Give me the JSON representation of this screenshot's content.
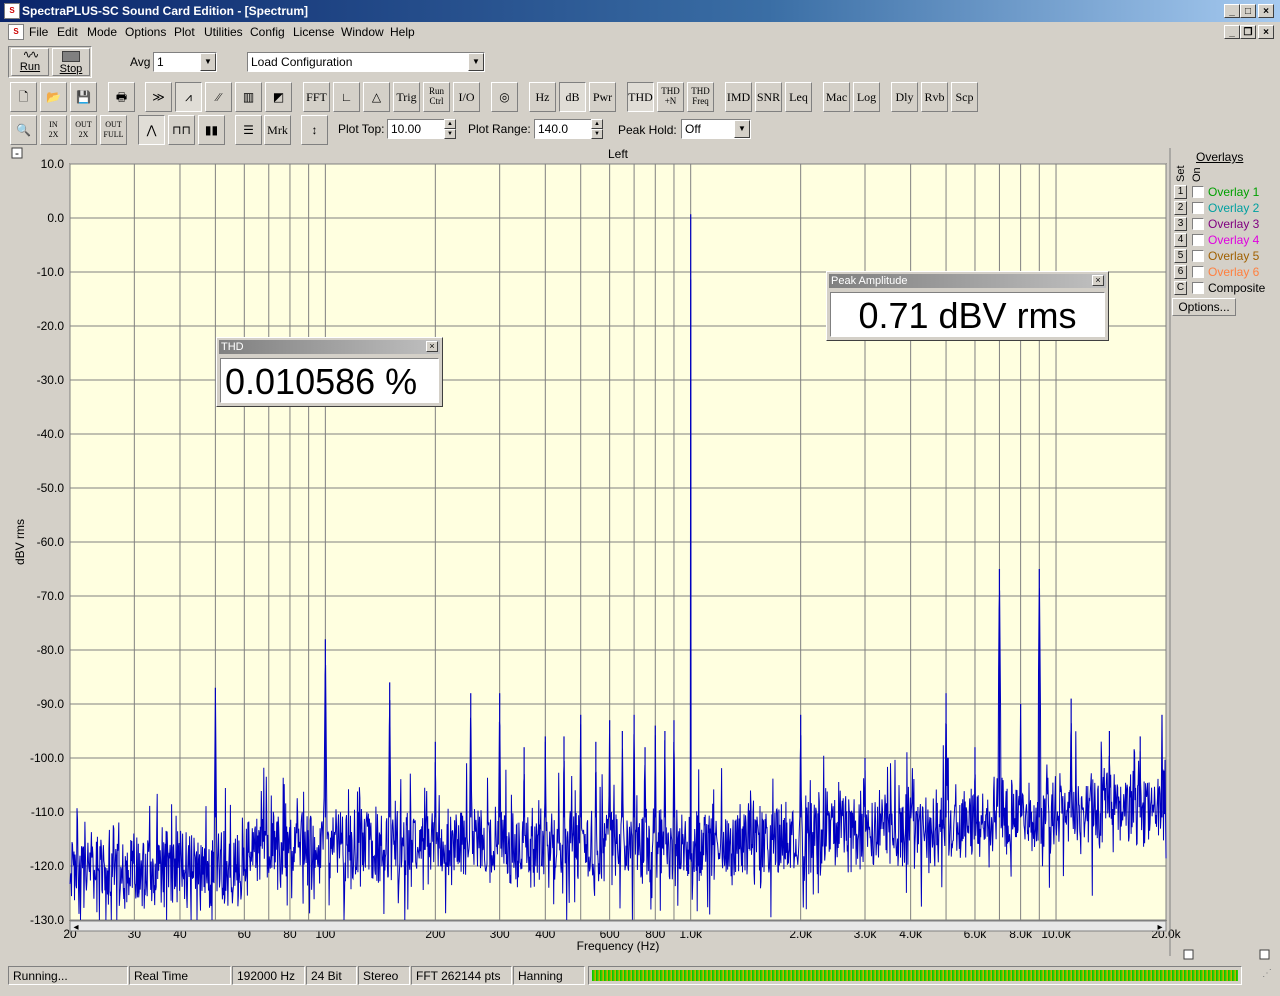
{
  "window": {
    "title": "SpectraPLUS-SC Sound Card Edition - [Spectrum]",
    "app_icon_text": "S"
  },
  "menu": [
    "File",
    "Edit",
    "Mode",
    "Options",
    "Plot",
    "Utilities",
    "Config",
    "License",
    "Window",
    "Help"
  ],
  "toolbar1": {
    "run_label": "Run",
    "stop_label": "Stop",
    "avg_label": "Avg",
    "avg_value": "1",
    "config_value": "Load Configuration"
  },
  "toolbar2": [
    "FFT",
    "Trig",
    "Run Ctrl",
    "I/O",
    "Hz",
    "dB",
    "Pwr",
    "THD",
    "THD +N",
    "THD Freq",
    "IMD",
    "SNR",
    "Leq",
    "Mac",
    "Log",
    "Dly",
    "Rvb",
    "Scp"
  ],
  "toolbar3": {
    "mrk_label": "Mrk",
    "plot_top_label": "Plot Top:",
    "plot_top_value": "10.00",
    "plot_range_label": "Plot Range:",
    "plot_range_value": "140.0",
    "peak_hold_label": "Peak Hold:",
    "peak_hold_value": "Off"
  },
  "plot": {
    "channel_title": "Left",
    "bg_color": "#ffffe0",
    "trace_color": "#0000c0"
  },
  "overlays": {
    "title": "Overlays",
    "col_set": "Set",
    "col_on": "On",
    "items": [
      {
        "num": "1",
        "label": "Overlay 1",
        "color": "#00a000"
      },
      {
        "num": "2",
        "label": "Overlay 2",
        "color": "#00a0a0"
      },
      {
        "num": "3",
        "label": "Overlay 3",
        "color": "#800080"
      },
      {
        "num": "4",
        "label": "Overlay 4",
        "color": "#e000e0"
      },
      {
        "num": "5",
        "label": "Overlay 5",
        "color": "#a06000"
      },
      {
        "num": "6",
        "label": "Overlay 6",
        "color": "#ff8040"
      },
      {
        "num": "C",
        "label": "Composite",
        "color": "#000000"
      }
    ],
    "options_button": "Options..."
  },
  "thd_window": {
    "title": "THD",
    "value": "0.010586 %"
  },
  "peak_window": {
    "title": "Peak Amplitude",
    "value": "0.71 dBV rms"
  },
  "status": {
    "state": "Running...",
    "mode": "Real Time",
    "rate": "192000 Hz",
    "bits": "24 Bit",
    "channels": "Stereo",
    "fft": "FFT 262144 pts",
    "window": "Hanning"
  },
  "chart_data": {
    "type": "line",
    "xlabel": "Frequency (Hz)",
    "ylabel": "dBV rms",
    "xscale": "log",
    "xlim": [
      20,
      20000
    ],
    "ylim": [
      -130,
      10
    ],
    "xticks": [
      "20",
      "30",
      "40",
      "60",
      "80",
      "100",
      "200",
      "300",
      "400",
      "600",
      "800",
      "1.0k",
      "2.0k",
      "3.0k",
      "4.0k",
      "6.0k",
      "8.0k",
      "10.0k",
      "20.0k"
    ],
    "yticks": [
      "10.0",
      "0.0",
      "-10.0",
      "-20.0",
      "-30.0",
      "-40.0",
      "-50.0",
      "-60.0",
      "-70.0",
      "-80.0",
      "-90.0",
      "-100.0",
      "-110.0",
      "-120.0",
      "-130.0"
    ],
    "grid": true,
    "noise_floor_db": -113,
    "peaks": [
      {
        "f": 50,
        "db": -87
      },
      {
        "f": 100,
        "db": -78
      },
      {
        "f": 150,
        "db": -86
      },
      {
        "f": 200,
        "db": -97
      },
      {
        "f": 250,
        "db": -88
      },
      {
        "f": 300,
        "db": -88
      },
      {
        "f": 350,
        "db": -98
      },
      {
        "f": 400,
        "db": -96
      },
      {
        "f": 450,
        "db": -96
      },
      {
        "f": 500,
        "db": -92
      },
      {
        "f": 550,
        "db": -97
      },
      {
        "f": 600,
        "db": -93
      },
      {
        "f": 650,
        "db": -95
      },
      {
        "f": 700,
        "db": -92
      },
      {
        "f": 750,
        "db": -98
      },
      {
        "f": 800,
        "db": -94
      },
      {
        "f": 850,
        "db": -95
      },
      {
        "f": 900,
        "db": -93
      },
      {
        "f": 1000,
        "db": 0.7
      },
      {
        "f": 2000,
        "db": -92
      },
      {
        "f": 3000,
        "db": -100
      },
      {
        "f": 5000,
        "db": -88
      },
      {
        "f": 6000,
        "db": -98
      },
      {
        "f": 7000,
        "db": -65
      },
      {
        "f": 8000,
        "db": -90
      },
      {
        "f": 9000,
        "db": -65
      },
      {
        "f": 11000,
        "db": -89
      },
      {
        "f": 14000,
        "db": -95
      },
      {
        "f": 17000,
        "db": -96
      },
      {
        "f": 19500,
        "db": -92
      }
    ]
  }
}
